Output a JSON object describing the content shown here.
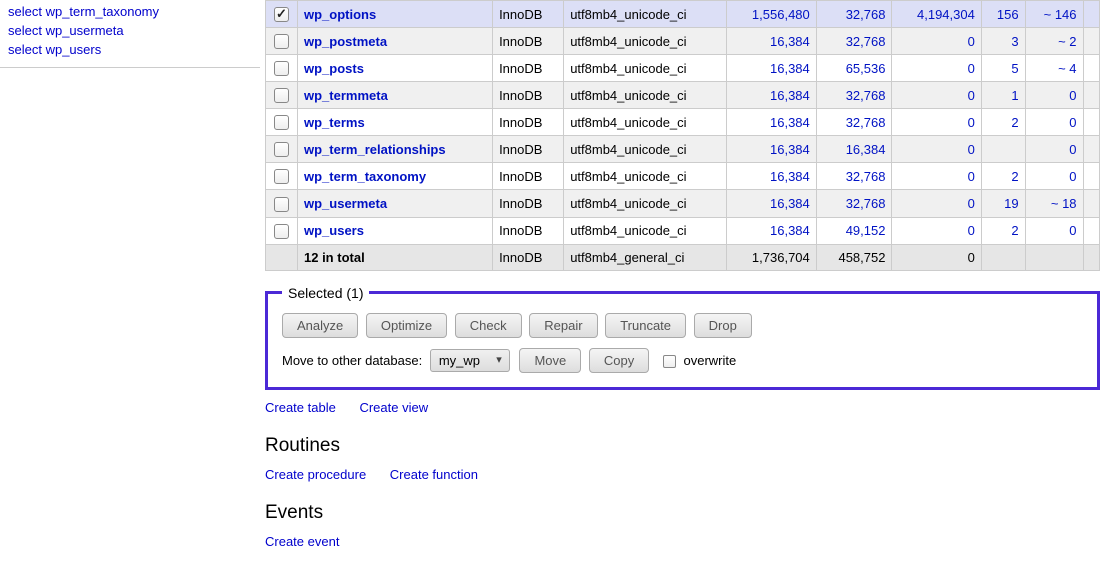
{
  "sidebar": {
    "items": [
      "select wp_term_taxonomy",
      "select wp_usermeta",
      "select wp_users"
    ]
  },
  "table": {
    "rows": [
      {
        "checked": true,
        "name": "wp_options",
        "engine": "InnoDB",
        "collation": "utf8mb4_unicode_ci",
        "data_len": "1,556,480",
        "idx_len": "32,768",
        "free": "4,194,304",
        "rows": "156",
        "auto": "~ 146"
      },
      {
        "checked": false,
        "name": "wp_postmeta",
        "engine": "InnoDB",
        "collation": "utf8mb4_unicode_ci",
        "data_len": "16,384",
        "idx_len": "32,768",
        "free": "0",
        "rows": "3",
        "auto": "~ 2"
      },
      {
        "checked": false,
        "name": "wp_posts",
        "engine": "InnoDB",
        "collation": "utf8mb4_unicode_ci",
        "data_len": "16,384",
        "idx_len": "65,536",
        "free": "0",
        "rows": "5",
        "auto": "~ 4"
      },
      {
        "checked": false,
        "name": "wp_termmeta",
        "engine": "InnoDB",
        "collation": "utf8mb4_unicode_ci",
        "data_len": "16,384",
        "idx_len": "32,768",
        "free": "0",
        "rows": "1",
        "auto": "0"
      },
      {
        "checked": false,
        "name": "wp_terms",
        "engine": "InnoDB",
        "collation": "utf8mb4_unicode_ci",
        "data_len": "16,384",
        "idx_len": "32,768",
        "free": "0",
        "rows": "2",
        "auto": "0"
      },
      {
        "checked": false,
        "name": "wp_term_relationships",
        "engine": "InnoDB",
        "collation": "utf8mb4_unicode_ci",
        "data_len": "16,384",
        "idx_len": "16,384",
        "free": "0",
        "rows": "",
        "auto": "0"
      },
      {
        "checked": false,
        "name": "wp_term_taxonomy",
        "engine": "InnoDB",
        "collation": "utf8mb4_unicode_ci",
        "data_len": "16,384",
        "idx_len": "32,768",
        "free": "0",
        "rows": "2",
        "auto": "0"
      },
      {
        "checked": false,
        "name": "wp_usermeta",
        "engine": "InnoDB",
        "collation": "utf8mb4_unicode_ci",
        "data_len": "16,384",
        "idx_len": "32,768",
        "free": "0",
        "rows": "19",
        "auto": "~ 18"
      },
      {
        "checked": false,
        "name": "wp_users",
        "engine": "InnoDB",
        "collation": "utf8mb4_unicode_ci",
        "data_len": "16,384",
        "idx_len": "49,152",
        "free": "0",
        "rows": "2",
        "auto": "0"
      }
    ],
    "total": {
      "label": "12 in total",
      "engine": "InnoDB",
      "collation": "utf8mb4_general_ci",
      "data_len": "1,736,704",
      "idx_len": "458,752",
      "free": "0"
    }
  },
  "selected": {
    "legend": "Selected (1)",
    "buttons": [
      "Analyze",
      "Optimize",
      "Check",
      "Repair",
      "Truncate",
      "Drop"
    ],
    "move_label": "Move to other database:",
    "db_value": "my_wp",
    "move_btn": "Move",
    "copy_btn": "Copy",
    "overwrite_label": "overwrite"
  },
  "links": {
    "create_table": "Create table",
    "create_view": "Create view"
  },
  "routines": {
    "heading": "Routines",
    "create_procedure": "Create procedure",
    "create_function": "Create function"
  },
  "events": {
    "heading": "Events",
    "create_event": "Create event"
  }
}
